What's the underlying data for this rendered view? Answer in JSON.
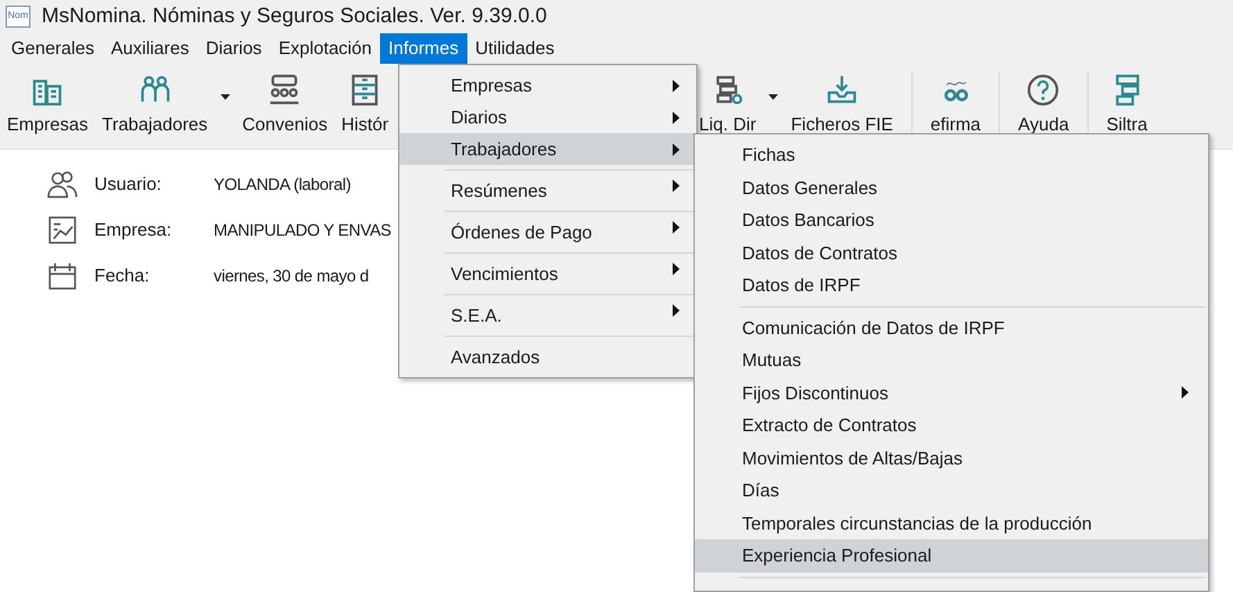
{
  "window": {
    "title": "MsNomina. Nóminas y Seguros Sociales. Ver. 9.39.0.0",
    "app_icon_text": "Nom"
  },
  "menu_bar": [
    {
      "label": "Generales",
      "selected": false
    },
    {
      "label": "Auxiliares",
      "selected": false
    },
    {
      "label": "Diarios",
      "selected": false
    },
    {
      "label": "Explotación",
      "selected": false
    },
    {
      "label": "Informes",
      "selected": true
    },
    {
      "label": "Utilidades",
      "selected": false
    }
  ],
  "toolbar": [
    {
      "label": "Empresas",
      "dropdown": false
    },
    {
      "label": "Trabajadores",
      "dropdown": true
    },
    {
      "label": "Convenios",
      "dropdown": false
    },
    {
      "label": "Histór",
      "dropdown": false
    },
    {
      "label": "Liq. Dir",
      "dropdown": true
    },
    {
      "label": "Ficheros FIE",
      "dropdown": false
    },
    {
      "label": "efirma",
      "dropdown": false
    },
    {
      "label": "Ayuda",
      "dropdown": false
    },
    {
      "label": "Siltra",
      "dropdown": false
    }
  ],
  "info": [
    {
      "label": "Usuario:",
      "value": "YOLANDA (laboral)"
    },
    {
      "label": "Empresa:",
      "value": "MANIPULADO Y ENVAS"
    },
    {
      "label": "Fecha:",
      "value": "viernes, 30 de mayo d"
    }
  ],
  "informes_menu": [
    {
      "label": "Empresas",
      "submenu": true,
      "selected": false,
      "separator_before": false
    },
    {
      "label": "Diarios",
      "submenu": true,
      "selected": false,
      "separator_before": false
    },
    {
      "label": "Trabajadores",
      "submenu": true,
      "selected": true,
      "separator_before": false
    },
    {
      "label": "Resúmenes",
      "submenu": true,
      "selected": false,
      "separator_before": true
    },
    {
      "label": "Órdenes de Pago",
      "submenu": true,
      "selected": false,
      "separator_before": true
    },
    {
      "label": "Vencimientos",
      "submenu": true,
      "selected": false,
      "separator_before": true
    },
    {
      "label": "S.E.A.",
      "submenu": true,
      "selected": false,
      "separator_before": true
    },
    {
      "label": "Avanzados",
      "submenu": false,
      "selected": false,
      "separator_before": true
    }
  ],
  "trabajadores_submenu": [
    {
      "label": "Fichas",
      "submenu": false,
      "selected": false,
      "separator_before": false
    },
    {
      "label": "Datos Generales",
      "submenu": false,
      "selected": false,
      "separator_before": false
    },
    {
      "label": "Datos Bancarios",
      "submenu": false,
      "selected": false,
      "separator_before": false
    },
    {
      "label": "Datos de Contratos",
      "submenu": false,
      "selected": false,
      "separator_before": false
    },
    {
      "label": "Datos de IRPF",
      "submenu": false,
      "selected": false,
      "separator_before": false
    },
    {
      "label": "Comunicación de Datos de IRPF",
      "submenu": false,
      "selected": false,
      "separator_before": true
    },
    {
      "label": "Mutuas",
      "submenu": false,
      "selected": false,
      "separator_before": false
    },
    {
      "label": "Fijos Discontinuos",
      "submenu": true,
      "selected": false,
      "separator_before": false
    },
    {
      "label": "Extracto de Contratos",
      "submenu": false,
      "selected": false,
      "separator_before": false
    },
    {
      "label": "Movimientos de Altas/Bajas",
      "submenu": false,
      "selected": false,
      "separator_before": false
    },
    {
      "label": "Días",
      "submenu": false,
      "selected": false,
      "separator_before": false
    },
    {
      "label": "Temporales circunstancias de la producción",
      "submenu": false,
      "selected": false,
      "separator_before": false
    },
    {
      "label": "Experiencia Profesional",
      "submenu": false,
      "selected": true,
      "separator_before": false
    }
  ]
}
